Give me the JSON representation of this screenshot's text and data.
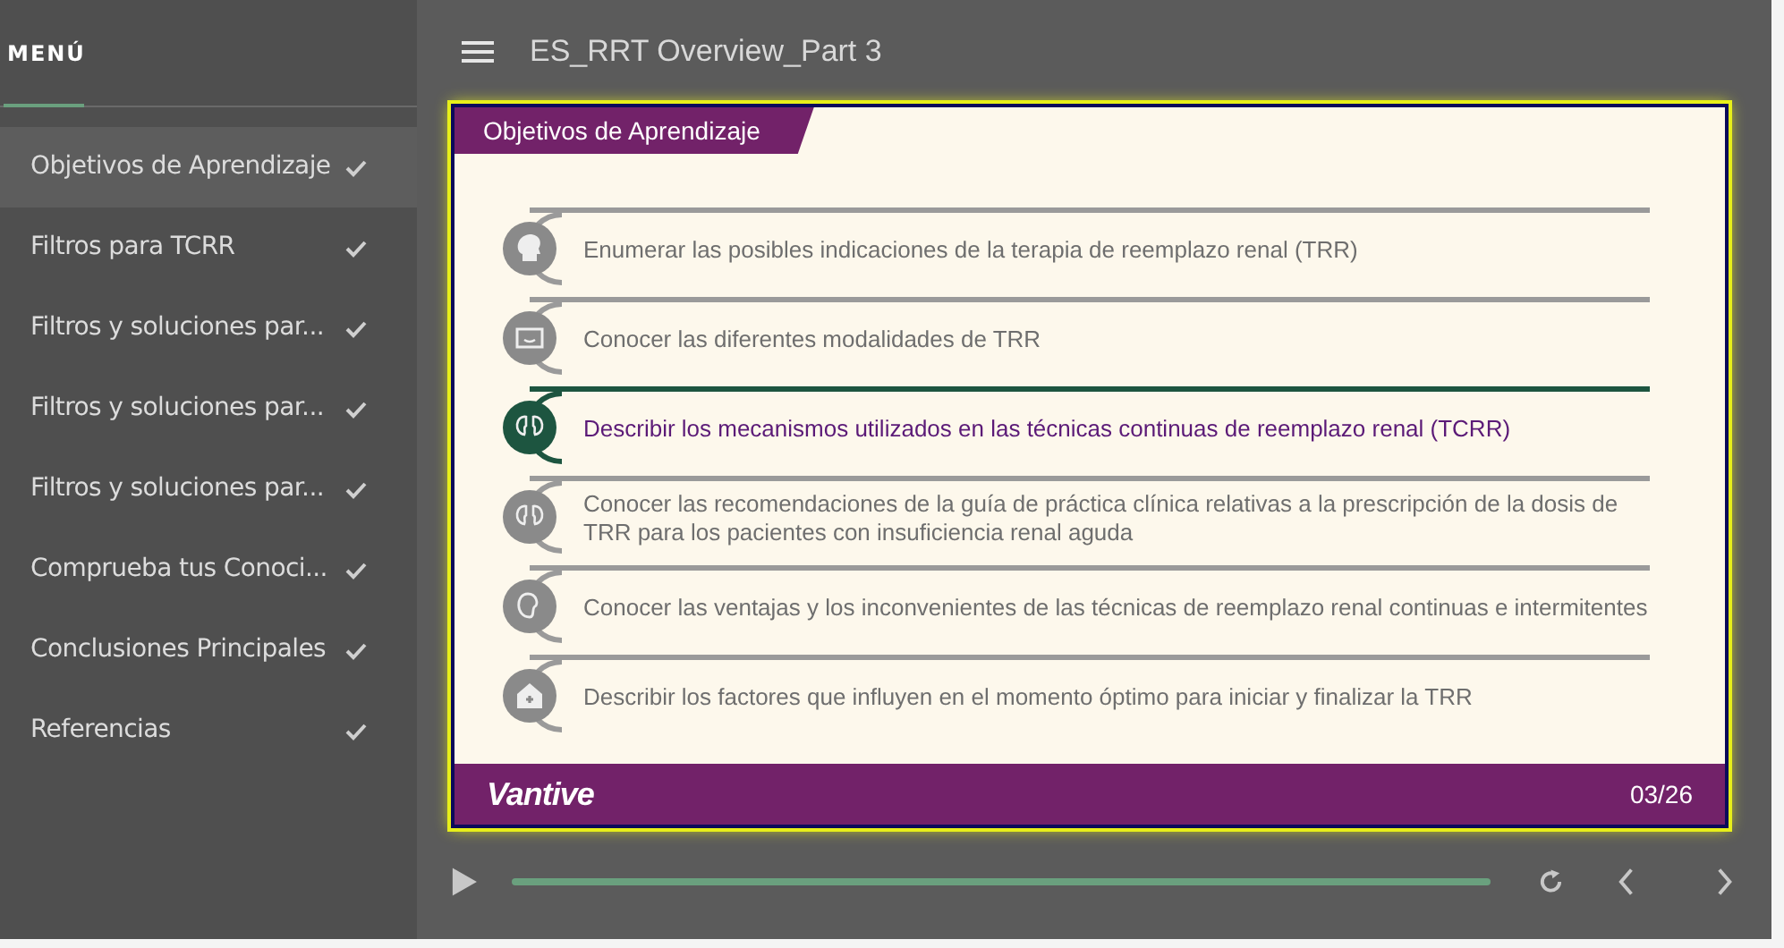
{
  "sidebar": {
    "title": "MENÚ",
    "items": [
      {
        "label": "Objetivos de Aprendizaje",
        "selected": true,
        "completed": true
      },
      {
        "label": "Filtros para TCRR",
        "selected": false,
        "completed": true
      },
      {
        "label": "Filtros y soluciones par...",
        "selected": false,
        "completed": true
      },
      {
        "label": "Filtros y soluciones par...",
        "selected": false,
        "completed": true
      },
      {
        "label": "Filtros y soluciones par...",
        "selected": false,
        "completed": true
      },
      {
        "label": "Comprueba tus Conoci...",
        "selected": false,
        "completed": true
      },
      {
        "label": "Conclusiones Principales",
        "selected": false,
        "completed": true
      },
      {
        "label": "Referencias",
        "selected": false,
        "completed": true
      }
    ]
  },
  "header": {
    "title": "ES_RRT Overview_Part 3"
  },
  "slide": {
    "tab": "Objetivos de Aprendizaje",
    "objectives": [
      {
        "kind": "head",
        "text": "Enumerar las posibles indicaciones de la terapia de reemplazo renal (TRR)",
        "selected": false
      },
      {
        "kind": "monitor",
        "text": "Conocer las diferentes modalidades de TRR",
        "selected": false
      },
      {
        "kind": "kidneys",
        "text": "Describir los mecanismos utilizados en las técnicas continuas de reemplazo renal (TCRR)",
        "selected": true
      },
      {
        "kind": "kidneys",
        "text": "Conocer las recomendaciones de la guía de práctica clínica relativas a la prescripción de la dosis de TRR para los pacientes con insuficiencia renal aguda",
        "selected": false
      },
      {
        "kind": "kidney",
        "text": "Conocer las ventajas y los inconvenientes de las técnicas de reemplazo renal continuas e intermitentes",
        "selected": false
      },
      {
        "kind": "house",
        "text": "Describir los factores que influyen en el momento óptimo para iniciar y finalizar la TRR",
        "selected": false
      }
    ],
    "logo": "Vantive",
    "page": "03/26"
  },
  "player": {
    "progress": {
      "level": 1
    }
  }
}
